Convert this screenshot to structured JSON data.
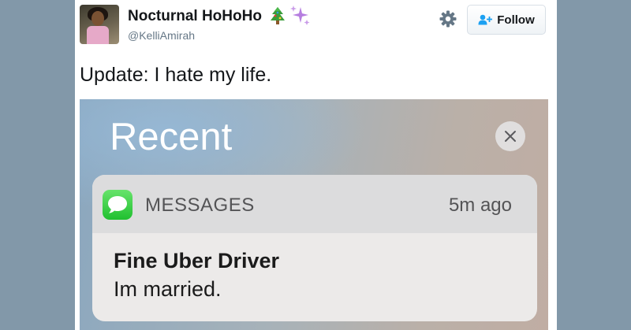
{
  "tweet": {
    "display_name": "Nocturnal HoHoHo",
    "emojis": [
      "christmas-tree",
      "sparkles"
    ],
    "handle": "@KelliAmirah",
    "follow_label": "Follow",
    "text": "Update: I hate my life."
  },
  "notification_center": {
    "title": "Recent",
    "notification": {
      "app_name": "MESSAGES",
      "time": "5m ago",
      "sender": "Fine Uber Driver",
      "message": "Im married."
    }
  },
  "colors": {
    "background": "#8298a9",
    "follow_icon_blue": "#1da1f2",
    "messages_green": "#2fce3c"
  }
}
